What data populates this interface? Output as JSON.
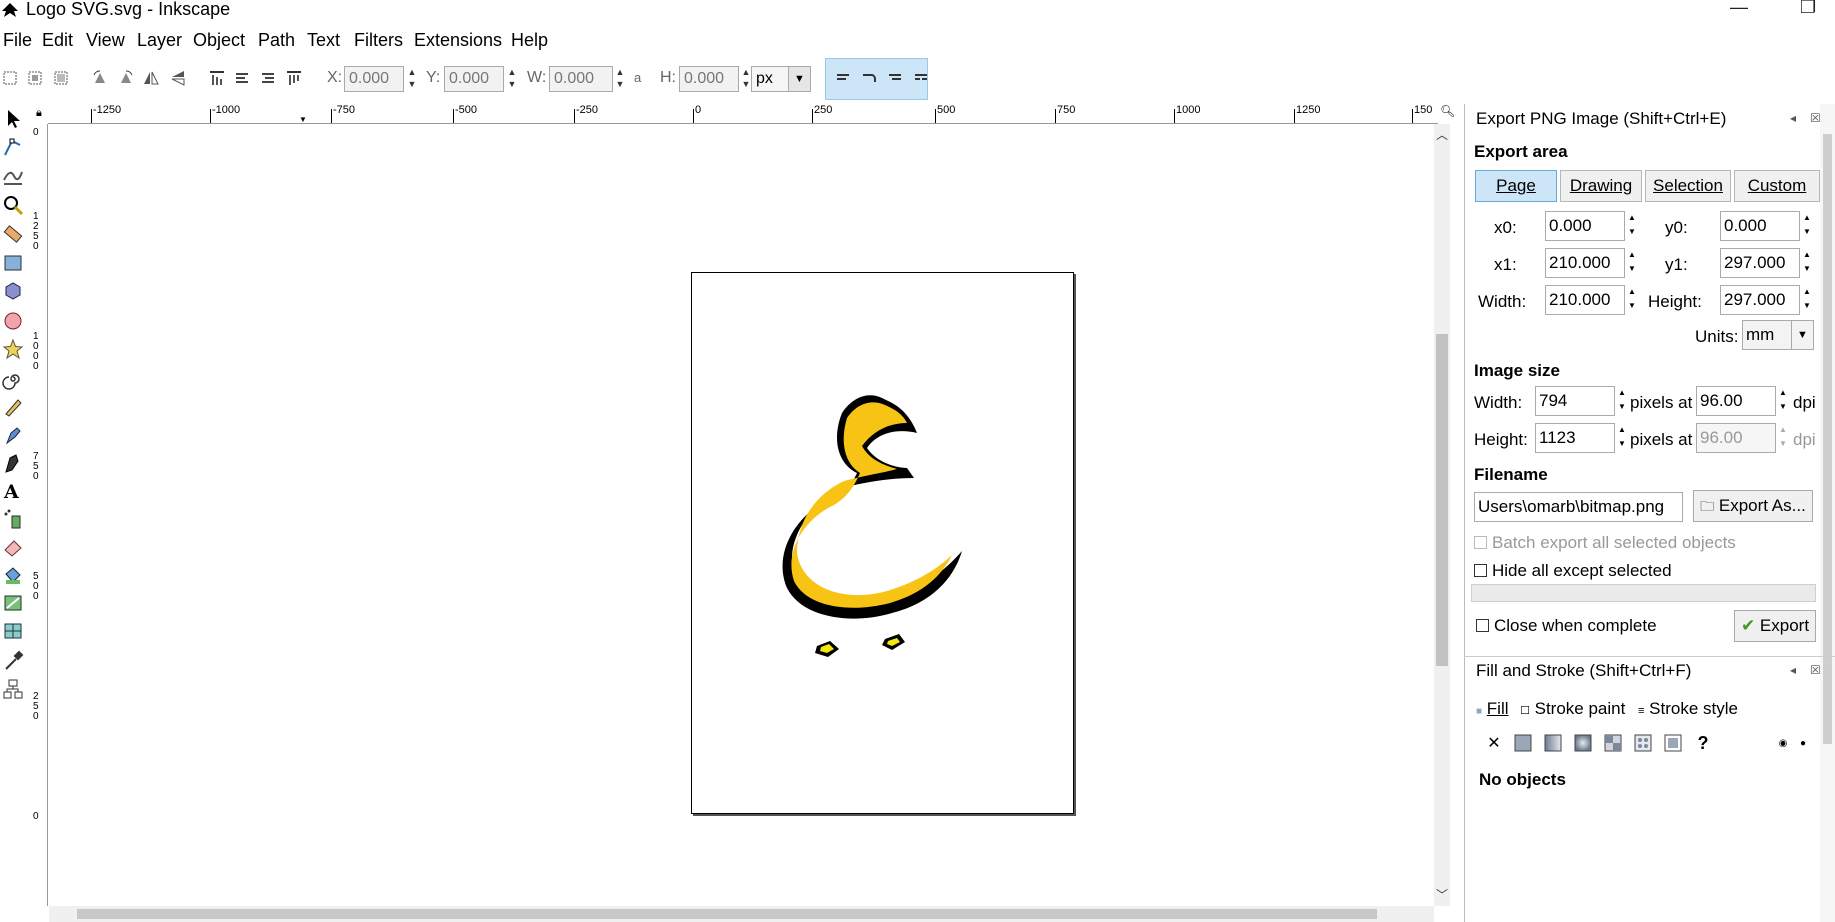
{
  "window": {
    "title": "Logo SVG.svg - Inkscape",
    "minimize_glyph": "—",
    "restore_glyph": "❐"
  },
  "menu": [
    "File",
    "Edit",
    "View",
    "Layer",
    "Object",
    "Path",
    "Text",
    "Filters",
    "Extensions",
    "Help"
  ],
  "toolbar": {
    "x_label": "X:",
    "x_value": "0.000",
    "y_label": "Y:",
    "y_value": "0.000",
    "w_label": "W:",
    "w_value": "0.000",
    "lock_glyph": "a",
    "h_label": "H:",
    "h_value": "0.000",
    "unit": "px"
  },
  "ruler": {
    "top_ticks": [
      "-1250",
      "-1000",
      "-750",
      "-500",
      "-250",
      "0",
      "250",
      "500",
      "750",
      "1000",
      "1250",
      "150"
    ],
    "left_ticks": [
      "0",
      "1250",
      "1000",
      "750",
      "500",
      "250",
      "0"
    ]
  },
  "export_panel": {
    "title": "Export PNG Image (Shift+Ctrl+E)",
    "export_area_heading": "Export area",
    "area_buttons": [
      "Page",
      "Drawing",
      "Selection",
      "Custom"
    ],
    "active_area": "Page",
    "x0_label": "x0:",
    "x0": "0.000",
    "y0_label": "y0:",
    "y0": "0.000",
    "x1_label": "x1:",
    "x1": "210.000",
    "y1_label": "y1:",
    "y1": "297.000",
    "width_label": "Width:",
    "width": "210.000",
    "height_label": "Height:",
    "height": "297.000",
    "units_label": "Units:",
    "units": "mm",
    "image_size_heading": "Image size",
    "img_width_label": "Width:",
    "img_width": "794",
    "img_height_label": "Height:",
    "img_height": "1123",
    "pixels_at": "pixels at",
    "dpi_value": "96.00",
    "dpi_value_disabled": "96.00",
    "dpi_label": "dpi",
    "filename_heading": "Filename",
    "filename": "Users\\omarb\\bitmap.png",
    "export_as_label": "Export As...",
    "batch_label": "Batch export all selected objects",
    "hide_label": "Hide all except selected",
    "close_label": "Close when complete",
    "export_label": "Export"
  },
  "fill_panel": {
    "title": "Fill and Stroke (Shift+Ctrl+F)",
    "tabs": [
      "Fill",
      "Stroke paint",
      "Stroke style"
    ],
    "none_glyph": "✕",
    "unknown_glyph": "?",
    "status": "No objects"
  },
  "colors": {
    "accent": "#cde6f7",
    "glyph_fill": "#f7c416",
    "glyph_stroke": "#000000",
    "dot_fill": "#f3e60e"
  }
}
